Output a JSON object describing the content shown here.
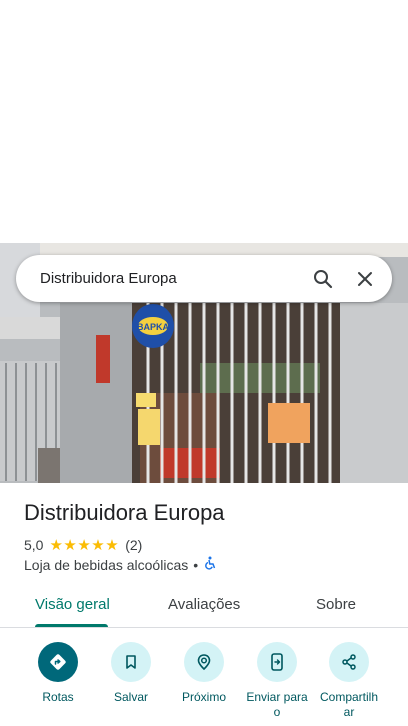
{
  "search": {
    "query": "Distribuidora Europa"
  },
  "place": {
    "name": "Distribuidora Europa",
    "rating": "5,0",
    "stars": "★★★★★",
    "reviews_count": "(2)",
    "category": "Loja de bebidas alcoólicas",
    "separator": "•"
  },
  "tabs": [
    "Visão geral",
    "Avaliações",
    "Sobre"
  ],
  "actions": [
    {
      "label": "Rotas",
      "icon": "directions-icon"
    },
    {
      "label": "Salvar",
      "icon": "bookmark-icon"
    },
    {
      "label": "Próximo",
      "icon": "nearby-icon"
    },
    {
      "label": "Enviar para o",
      "icon": "send-to-phone-icon"
    },
    {
      "label": "Compartilhar",
      "icon": "share-icon"
    }
  ],
  "photo": {
    "sign_text": "BAPKA"
  },
  "colors": {
    "accent": "#00796b",
    "primary_button": "#00687a",
    "chip_bg": "#d4f3f6",
    "star": "#fbbc04"
  }
}
